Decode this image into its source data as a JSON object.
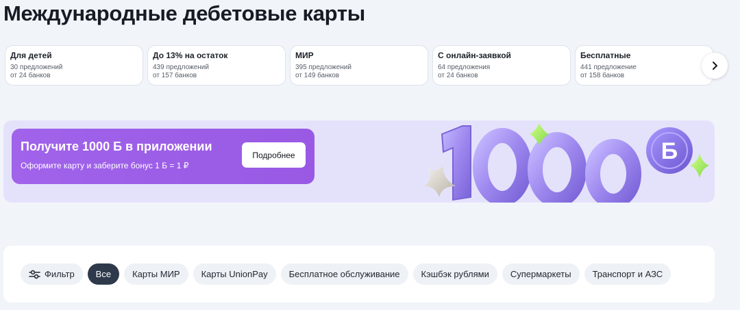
{
  "page": {
    "title": "Международные дебетовые карты"
  },
  "categories": [
    {
      "title": "Для детей",
      "offers": "30 предложений",
      "banks": "от 24 банков"
    },
    {
      "title": "До 13% на остаток",
      "offers": "439 предложений",
      "banks": "от 157 банков"
    },
    {
      "title": "МИР",
      "offers": "395 предложений",
      "banks": "от 149 банков"
    },
    {
      "title": "С онлайн-заявкой",
      "offers": "64 предложения",
      "banks": "от 24 банков"
    },
    {
      "title": "Бесплатные",
      "offers": "441 предложение",
      "banks": "от 158 банков"
    }
  ],
  "carousel": {
    "next_icon": "chevron-right-icon"
  },
  "promo": {
    "title": "Получите 1000 Б в приложении",
    "subtitle": "Оформите карту и заберите бонус 1 Б = 1 ₽",
    "button_label": "Подробнее",
    "art_amount": "1000",
    "art_coin_letter": "Б",
    "colors": {
      "banner_bg": "#e4e2fb",
      "card_bg": "#9d5fe8",
      "digits": "#a28ef0"
    }
  },
  "filters": {
    "filter_label": "Фильтр",
    "filter_icon": "sliders-icon",
    "chips": [
      {
        "label": "Все",
        "active": true
      },
      {
        "label": "Карты МИР",
        "active": false
      },
      {
        "label": "Карты UnionPay",
        "active": false
      },
      {
        "label": "Бесплатное обслуживание",
        "active": false
      },
      {
        "label": "Кэшбэк рублями",
        "active": false
      },
      {
        "label": "Супермаркеты",
        "active": false
      },
      {
        "label": "Транспорт и АЗС",
        "active": false
      }
    ]
  }
}
